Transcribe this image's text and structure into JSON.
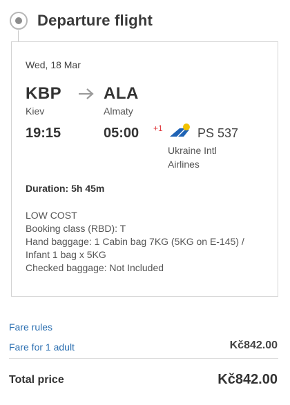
{
  "section": {
    "title": "Departure flight"
  },
  "flight": {
    "date": "Wed, 18 Mar",
    "from_code": "KBP",
    "to_code": "ALA",
    "from_city": "Kiev",
    "to_city": "Almaty",
    "departure_time": "19:15",
    "arrival_time": "05:00",
    "day_offset": "+1",
    "flight_number": "PS 537",
    "airline_line1": "Ukraine Intl",
    "airline_line2": "Airlines",
    "duration": "Duration: 5h 45m",
    "fare_type": "LOW COST",
    "booking_class": "Booking class (RBD):  T",
    "hand_baggage": "Hand baggage: 1 Cabin bag 7KG (5KG on E-145) / Infant 1 bag x 5KG",
    "checked_baggage": "Checked baggage: Not Included"
  },
  "fare": {
    "rules_link": "Fare rules",
    "adult_link": "Fare for 1 adult",
    "adult_amount": "Kč842.00"
  },
  "total": {
    "label": "Total price",
    "amount": "Kč842.00"
  },
  "icons": {
    "radio": "radio-selected-icon",
    "arrow": "arrow-right-icon",
    "airline_logo": "ukraine-intl-airlines-logo-icon"
  },
  "colors": {
    "link": "#2a6eb0",
    "day_offset": "#e0393e",
    "logo_blue": "#1f63b5",
    "logo_yellow": "#f2c200"
  }
}
